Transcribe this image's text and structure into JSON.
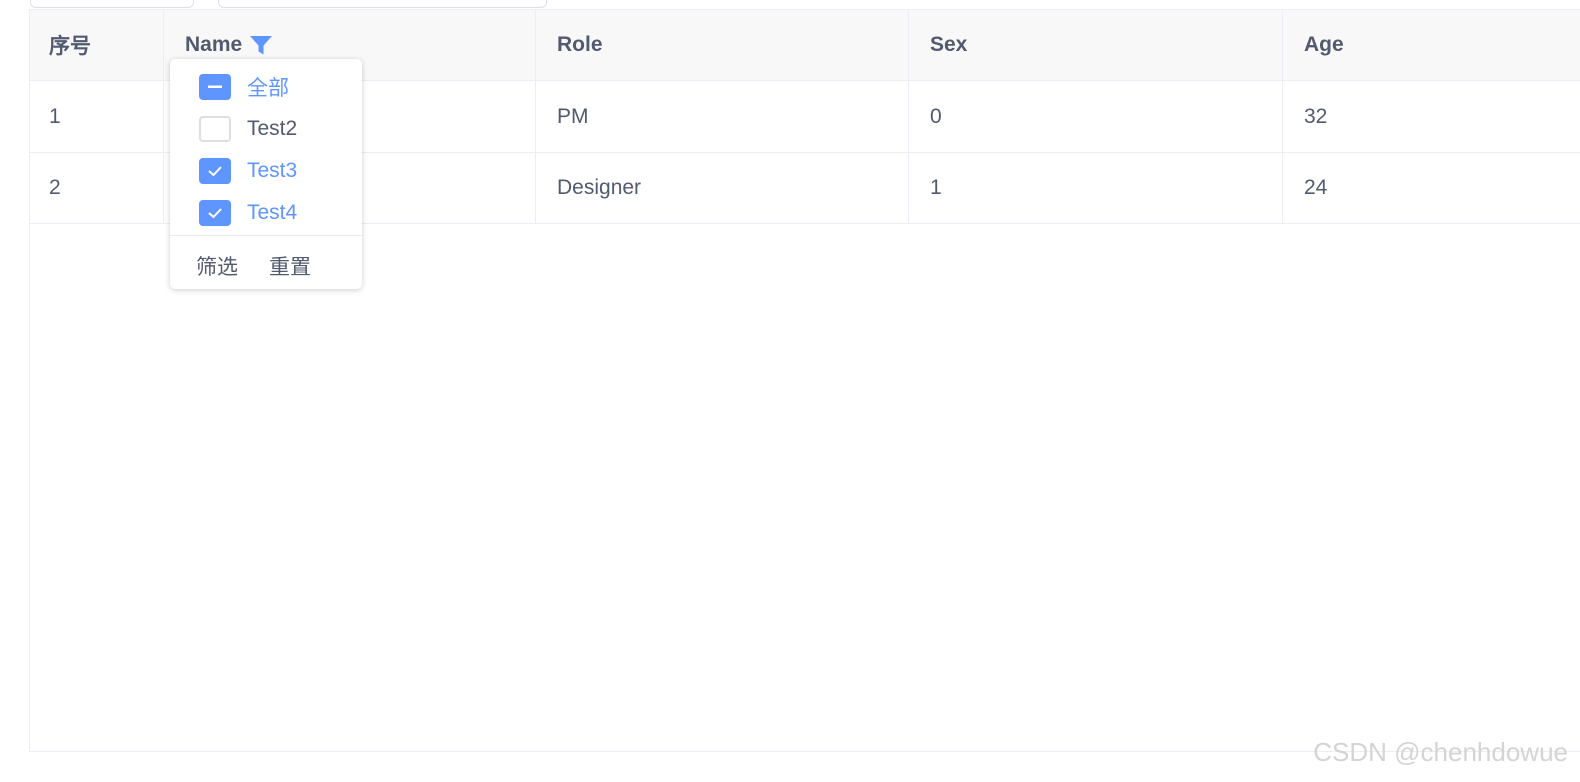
{
  "colors": {
    "accent": "#5f95ff",
    "header_bg": "#f8f8f9",
    "border": "#ebeef5",
    "text": "#515a6e"
  },
  "table": {
    "columns": [
      "序号",
      "Name",
      "Role",
      "Sex",
      "Age"
    ],
    "name_filter_icon": "filter-icon",
    "rows": [
      {
        "index": "1",
        "role": "PM",
        "sex": "0",
        "age": "32"
      },
      {
        "index": "2",
        "role": "Designer",
        "sex": "1",
        "age": "24"
      }
    ]
  },
  "filter_dropdown": {
    "options": [
      {
        "label": "全部",
        "state": "indeterminate"
      },
      {
        "label": "Test2",
        "state": "unchecked"
      },
      {
        "label": "Test3",
        "state": "checked"
      },
      {
        "label": "Test4",
        "state": "checked"
      }
    ],
    "confirm_label": "筛选",
    "reset_label": "重置"
  },
  "watermark": "CSDN @chenhdowue"
}
